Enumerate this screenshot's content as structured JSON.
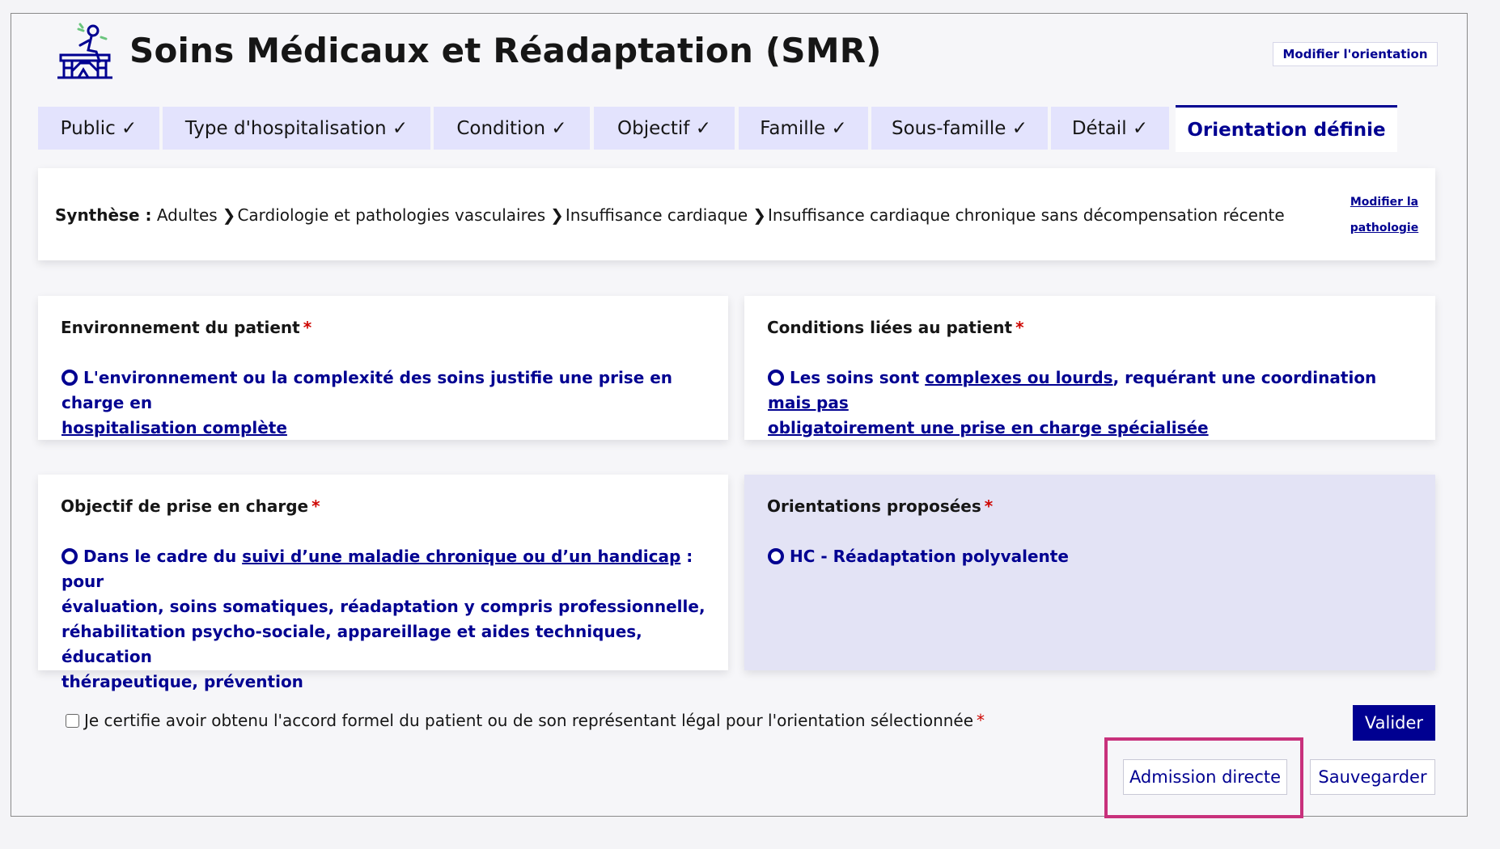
{
  "header": {
    "title": "Soins Médicaux et Réadaptation (SMR)",
    "logo_icon": "rehab-patient-icon",
    "modify_orientation_label": "Modifier l'orientation"
  },
  "tabs": [
    {
      "label": "Public ✓"
    },
    {
      "label": "Type d'hospitalisation ✓"
    },
    {
      "label": "Condition ✓"
    },
    {
      "label": "Objectif ✓"
    },
    {
      "label": "Famille ✓"
    },
    {
      "label": "Sous-famille ✓"
    },
    {
      "label": "Détail ✓"
    },
    {
      "label": "Orientation définie",
      "active": true
    }
  ],
  "summary": {
    "label": "Synthèse :",
    "crumbs": [
      "Adultes",
      "Cardiologie et pathologies vasculaires",
      "Insuffisance cardiaque",
      "Insuffisance cardiaque chronique sans décompensation récente"
    ],
    "separator": "❯",
    "modify_link_line1": "Modifier la",
    "modify_link_line2": "pathologie"
  },
  "cards": {
    "environment": {
      "label": "Environnement du patient",
      "required_mark": "*",
      "value_part1": "L'environnement ou la complexité des soins justifie une prise en charge en",
      "value_part2_underlined": "hospitalisation complète"
    },
    "conditions": {
      "label": "Conditions liées au patient",
      "required_mark": "*",
      "value_part1": "Les soins sont ",
      "value_part2_underlined": "complexes ou lourds",
      "value_part3": ", requérant une coordination ",
      "value_part4_underlined": "mais pas",
      "value_part5_underlined": "obligatoirement une prise en charge spécialisée"
    },
    "objective": {
      "label": "Objectif de prise en charge",
      "required_mark": "*",
      "value_part1": "Dans le cadre du ",
      "value_part2_underlined": "suivi d’une maladie chronique ou d’un handicap",
      "value_part3": " : pour",
      "value_line2": "évaluation, soins somatiques, réadaptation y compris professionnelle,",
      "value_line3": "réhabilitation psycho-sociale, appareillage et aides techniques, éducation",
      "value_line4": "thérapeutique, prévention"
    },
    "orientations": {
      "label": "Orientations proposées",
      "required_mark": "*",
      "value": "HC - Réadaptation polyvalente"
    }
  },
  "consent": {
    "text": "Je certifie avoir obtenu l'accord formel du patient ou de son représentant légal pour l'orientation sélectionnée",
    "required_mark": "*",
    "checked": false
  },
  "actions": {
    "validate_label": "Valider",
    "direct_admission_label": "Admission directe",
    "save_label": "Sauvegarder"
  },
  "colors": {
    "primary": "#000091",
    "tab_bg": "#e3e3fd",
    "required": "#ce0500",
    "highlight": "#c8317c"
  }
}
